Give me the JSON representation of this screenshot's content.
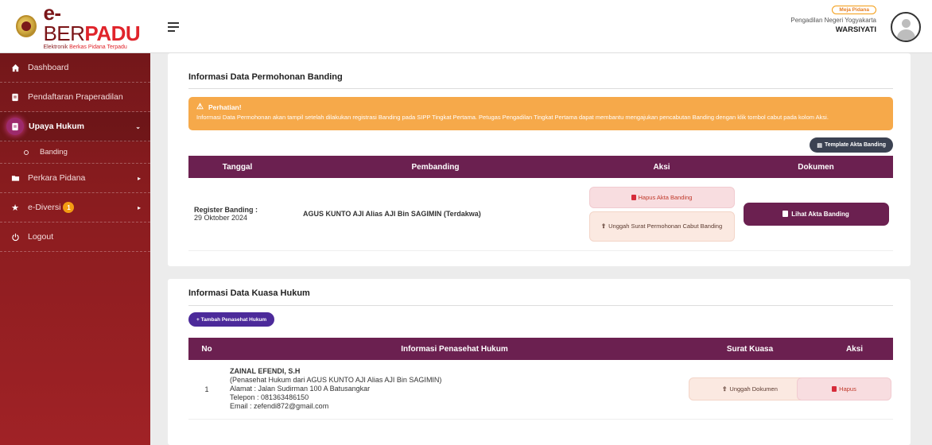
{
  "app": {
    "logo_title_e": "e-",
    "logo_title_ber": "BER",
    "logo_title_padu": "PADU",
    "logo_sub_1": "Elektronik ",
    "logo_sub_2": "Berkas Pidana Terpadu"
  },
  "sidebar": {
    "items": [
      {
        "label": "Dashboard",
        "icon": "home-icon"
      },
      {
        "label": "Pendaftaran Praperadilan",
        "icon": "document-icon"
      },
      {
        "label": "Upaya Hukum",
        "icon": "document-icon"
      },
      {
        "label": "Banding",
        "icon": "circle-icon"
      },
      {
        "label": "Perkara Pidana",
        "icon": "folder-icon"
      },
      {
        "label": "e-Diversi",
        "icon": "star-icon",
        "badge": "1"
      },
      {
        "label": "Logout",
        "icon": "power-icon"
      }
    ]
  },
  "topbar": {
    "role": "Meja Pidana",
    "court": "Pengadilan Negeri Yogyakarta",
    "user": "WARSIYATI"
  },
  "banding": {
    "title": "Informasi Data Permohonan Banding",
    "alert_title": "Perhatian!",
    "alert_msg": "Informasi Data Permohonan akan tampil setelah dilakukan registrasi Banding pada SIPP Tingkat Pertama. Petugas Pengadilan Tingkat Pertama dapat membantu mengajukan pencabutan Banding dengan klik tombol cabut pada kolom Aksi.",
    "template_btn": "Template Akta Banding",
    "headers": [
      "Tanggal",
      "Pembanding",
      "Aksi",
      "Dokumen"
    ],
    "row": {
      "register_label": "Register Banding :",
      "date": "29 Oktober 2024",
      "pembanding": "AGUS KUNTO AJI Alias AJI Bin SAGIMIN (Terdakwa)",
      "hapus_btn": "Hapus Akta Banding",
      "unggah_btn": "Unggah Surat Permohonan Cabut Banding",
      "lihat_btn": "Lihat Akta Banding"
    }
  },
  "kuasa": {
    "title": "Informasi Data Kuasa Hukum",
    "add_btn": "+ Tambah Penasehat Hukum",
    "headers": [
      "No",
      "Informasi Penasehat Hukum",
      "Surat Kuasa",
      "Aksi"
    ],
    "row": {
      "no": "1",
      "name": "ZAINAL EFENDI, S.H",
      "role": "(Penasehat Hukum dari AGUS KUNTO AJI Alias AJI Bin SAGIMIN)",
      "alamat": "Alamat : Jalan Sudirman 100 A Batusangkar",
      "telepon": "Telepon : 081363486150",
      "email": "Email : zefendi872@gmail.com",
      "unggah_btn": "Unggah Dokumen",
      "hapus_btn": "Hapus"
    }
  }
}
